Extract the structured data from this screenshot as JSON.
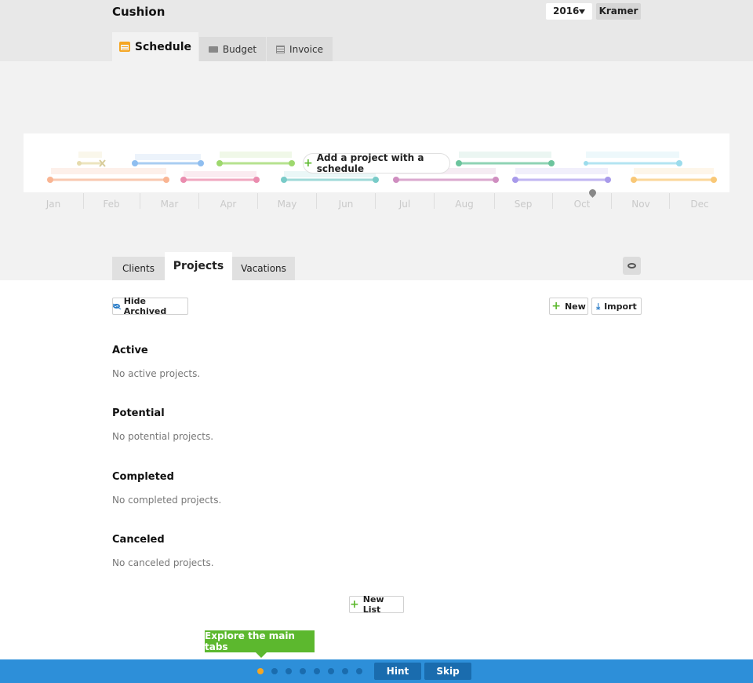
{
  "app": {
    "title": "Cushion",
    "year": "2016",
    "user": "Kramer"
  },
  "main_tabs": [
    {
      "label": "Schedule",
      "icon": "calendar-icon",
      "active": true
    },
    {
      "label": "Budget",
      "icon": "money-icon",
      "active": false
    },
    {
      "label": "Invoice",
      "icon": "document-icon",
      "active": false
    }
  ],
  "schedule": {
    "add_project_label": "Add a project with a schedule",
    "months": [
      "Jan",
      "Feb",
      "Mar",
      "Apr",
      "May",
      "Jun",
      "Jul",
      "Aug",
      "Sep",
      "Oct",
      "Nov",
      "Dec"
    ]
  },
  "sub_tabs": [
    {
      "label": "Clients",
      "active": false
    },
    {
      "label": "Projects",
      "active": true
    },
    {
      "label": "Vacations",
      "active": false
    }
  ],
  "toolbar": {
    "hide_archived": "Hide Archived",
    "new": "New",
    "import": "Import"
  },
  "sections": [
    {
      "title": "Active",
      "empty": "No active projects."
    },
    {
      "title": "Potential",
      "empty": "No potential projects."
    },
    {
      "title": "Completed",
      "empty": "No completed projects."
    },
    {
      "title": "Canceled",
      "empty": "No canceled projects."
    }
  ],
  "new_list_label": "New List",
  "tour": {
    "tip": "Explore the main tabs",
    "step": 1,
    "total_steps": 8,
    "hint_label": "Hint",
    "skip_label": "Skip"
  },
  "colors": {
    "accent_green": "#5cb82e",
    "accent_orange": "#f5a623",
    "tour_blue": "#2d8fd9",
    "link_blue": "#2a7cc7"
  }
}
